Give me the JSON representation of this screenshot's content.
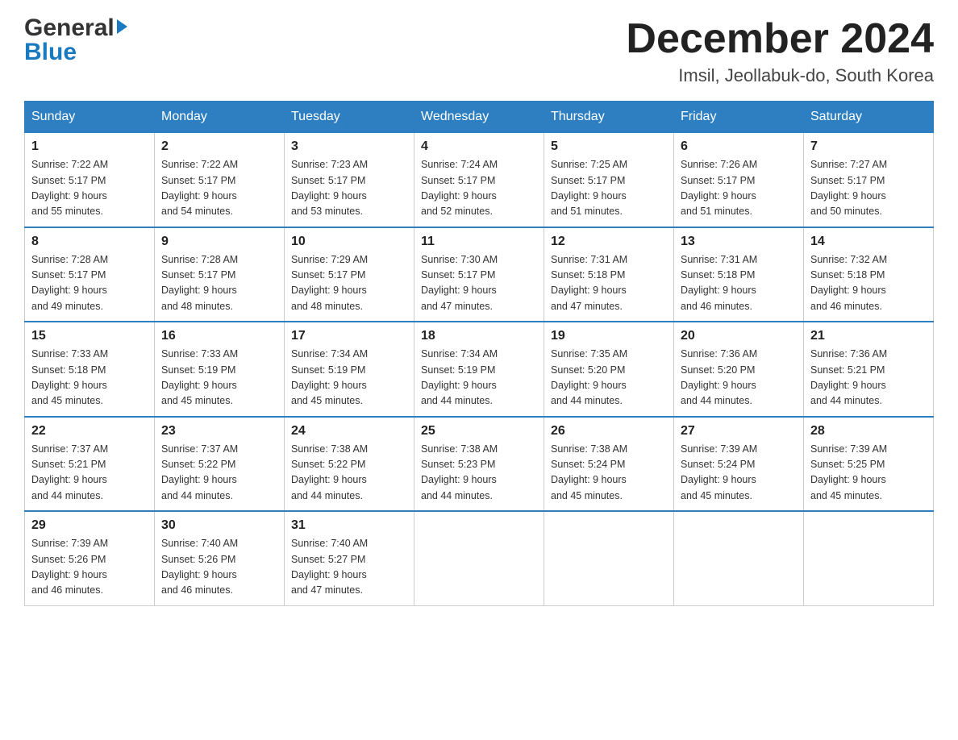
{
  "header": {
    "month_title": "December 2024",
    "location": "Imsil, Jeollabuk-do, South Korea",
    "logo_general": "General",
    "logo_blue": "Blue"
  },
  "days_of_week": [
    "Sunday",
    "Monday",
    "Tuesday",
    "Wednesday",
    "Thursday",
    "Friday",
    "Saturday"
  ],
  "weeks": [
    [
      {
        "day": "1",
        "sunrise": "7:22 AM",
        "sunset": "5:17 PM",
        "daylight": "9 hours and 55 minutes."
      },
      {
        "day": "2",
        "sunrise": "7:22 AM",
        "sunset": "5:17 PM",
        "daylight": "9 hours and 54 minutes."
      },
      {
        "day": "3",
        "sunrise": "7:23 AM",
        "sunset": "5:17 PM",
        "daylight": "9 hours and 53 minutes."
      },
      {
        "day": "4",
        "sunrise": "7:24 AM",
        "sunset": "5:17 PM",
        "daylight": "9 hours and 52 minutes."
      },
      {
        "day": "5",
        "sunrise": "7:25 AM",
        "sunset": "5:17 PM",
        "daylight": "9 hours and 51 minutes."
      },
      {
        "day": "6",
        "sunrise": "7:26 AM",
        "sunset": "5:17 PM",
        "daylight": "9 hours and 51 minutes."
      },
      {
        "day": "7",
        "sunrise": "7:27 AM",
        "sunset": "5:17 PM",
        "daylight": "9 hours and 50 minutes."
      }
    ],
    [
      {
        "day": "8",
        "sunrise": "7:28 AM",
        "sunset": "5:17 PM",
        "daylight": "9 hours and 49 minutes."
      },
      {
        "day": "9",
        "sunrise": "7:28 AM",
        "sunset": "5:17 PM",
        "daylight": "9 hours and 48 minutes."
      },
      {
        "day": "10",
        "sunrise": "7:29 AM",
        "sunset": "5:17 PM",
        "daylight": "9 hours and 48 minutes."
      },
      {
        "day": "11",
        "sunrise": "7:30 AM",
        "sunset": "5:17 PM",
        "daylight": "9 hours and 47 minutes."
      },
      {
        "day": "12",
        "sunrise": "7:31 AM",
        "sunset": "5:18 PM",
        "daylight": "9 hours and 47 minutes."
      },
      {
        "day": "13",
        "sunrise": "7:31 AM",
        "sunset": "5:18 PM",
        "daylight": "9 hours and 46 minutes."
      },
      {
        "day": "14",
        "sunrise": "7:32 AM",
        "sunset": "5:18 PM",
        "daylight": "9 hours and 46 minutes."
      }
    ],
    [
      {
        "day": "15",
        "sunrise": "7:33 AM",
        "sunset": "5:18 PM",
        "daylight": "9 hours and 45 minutes."
      },
      {
        "day": "16",
        "sunrise": "7:33 AM",
        "sunset": "5:19 PM",
        "daylight": "9 hours and 45 minutes."
      },
      {
        "day": "17",
        "sunrise": "7:34 AM",
        "sunset": "5:19 PM",
        "daylight": "9 hours and 45 minutes."
      },
      {
        "day": "18",
        "sunrise": "7:34 AM",
        "sunset": "5:19 PM",
        "daylight": "9 hours and 44 minutes."
      },
      {
        "day": "19",
        "sunrise": "7:35 AM",
        "sunset": "5:20 PM",
        "daylight": "9 hours and 44 minutes."
      },
      {
        "day": "20",
        "sunrise": "7:36 AM",
        "sunset": "5:20 PM",
        "daylight": "9 hours and 44 minutes."
      },
      {
        "day": "21",
        "sunrise": "7:36 AM",
        "sunset": "5:21 PM",
        "daylight": "9 hours and 44 minutes."
      }
    ],
    [
      {
        "day": "22",
        "sunrise": "7:37 AM",
        "sunset": "5:21 PM",
        "daylight": "9 hours and 44 minutes."
      },
      {
        "day": "23",
        "sunrise": "7:37 AM",
        "sunset": "5:22 PM",
        "daylight": "9 hours and 44 minutes."
      },
      {
        "day": "24",
        "sunrise": "7:38 AM",
        "sunset": "5:22 PM",
        "daylight": "9 hours and 44 minutes."
      },
      {
        "day": "25",
        "sunrise": "7:38 AM",
        "sunset": "5:23 PM",
        "daylight": "9 hours and 44 minutes."
      },
      {
        "day": "26",
        "sunrise": "7:38 AM",
        "sunset": "5:24 PM",
        "daylight": "9 hours and 45 minutes."
      },
      {
        "day": "27",
        "sunrise": "7:39 AM",
        "sunset": "5:24 PM",
        "daylight": "9 hours and 45 minutes."
      },
      {
        "day": "28",
        "sunrise": "7:39 AM",
        "sunset": "5:25 PM",
        "daylight": "9 hours and 45 minutes."
      }
    ],
    [
      {
        "day": "29",
        "sunrise": "7:39 AM",
        "sunset": "5:26 PM",
        "daylight": "9 hours and 46 minutes."
      },
      {
        "day": "30",
        "sunrise": "7:40 AM",
        "sunset": "5:26 PM",
        "daylight": "9 hours and 46 minutes."
      },
      {
        "day": "31",
        "sunrise": "7:40 AM",
        "sunset": "5:27 PM",
        "daylight": "9 hours and 47 minutes."
      },
      null,
      null,
      null,
      null
    ]
  ],
  "labels": {
    "sunrise_prefix": "Sunrise: ",
    "sunset_prefix": "Sunset: ",
    "daylight_prefix": "Daylight: "
  }
}
